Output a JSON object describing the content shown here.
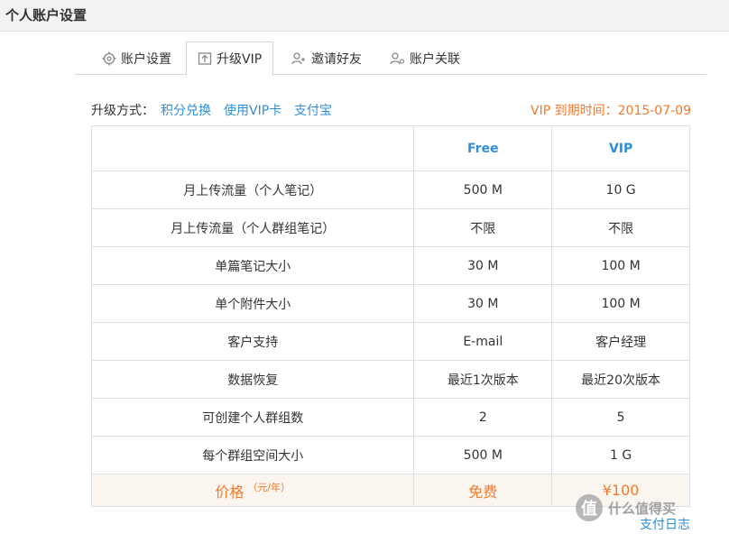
{
  "header": {
    "title": "个人账户设置"
  },
  "tabs": [
    {
      "label": "账户设置",
      "icon": "gear-icon"
    },
    {
      "label": "升级VIP",
      "icon": "upload-icon",
      "active": true
    },
    {
      "label": "邀请好友",
      "icon": "add-user-icon"
    },
    {
      "label": "账户关联",
      "icon": "linked-user-icon"
    }
  ],
  "upgrade": {
    "label": "升级方式：",
    "methods": [
      "积分兑换",
      "使用VIP卡",
      "支付宝"
    ],
    "expiry": "VIP 到期时间：2015-07-09"
  },
  "table": {
    "headers": [
      "",
      "Free",
      "VIP"
    ],
    "rows": [
      [
        "月上传流量（个人笔记）",
        "500 M",
        "10 G"
      ],
      [
        "月上传流量（个人群组笔记）",
        "不限",
        "不限"
      ],
      [
        "单篇笔记大小",
        "30 M",
        "100 M"
      ],
      [
        "单个附件大小",
        "30 M",
        "100 M"
      ],
      [
        "客户支持",
        "E-mail",
        "客户经理"
      ],
      [
        "数据恢复",
        "最近1次版本",
        "最近20次版本"
      ],
      [
        "可创建个人群组数",
        "2",
        "5"
      ],
      [
        "每个群组空间大小",
        "500 M",
        "1 G"
      ]
    ],
    "price": {
      "label": "价格",
      "unit": "（元/年）",
      "free": "免费",
      "vip": "¥100"
    }
  },
  "footer": {
    "pay_log": "支付日志"
  },
  "watermark": {
    "glyph": "值",
    "text": "什么值得买"
  },
  "colors": {
    "link": "#2f8fd6",
    "accent": "#f07a2c",
    "header_bg": "#f2f2f2"
  }
}
